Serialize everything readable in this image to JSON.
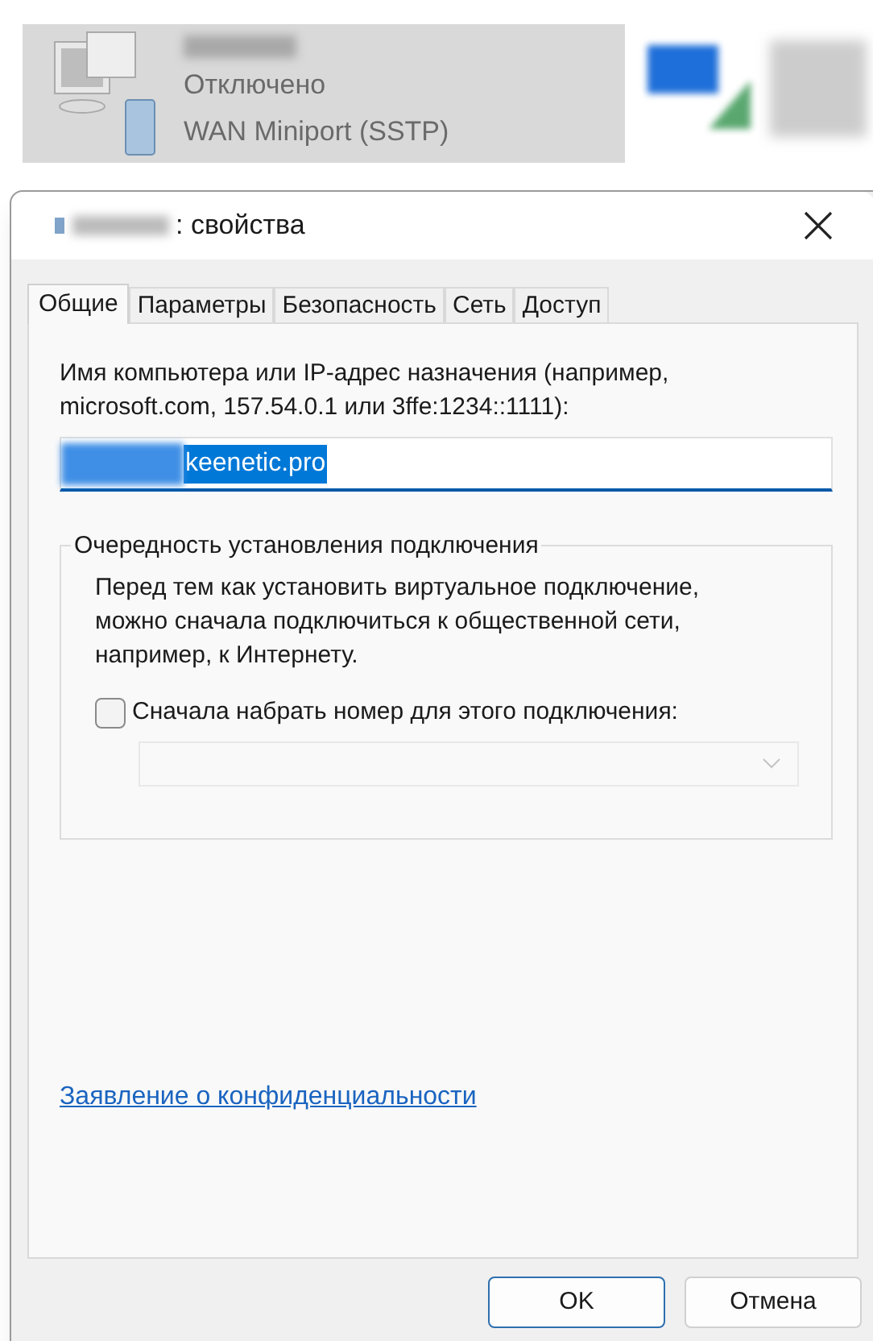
{
  "background_item": {
    "status": "Отключено",
    "device": "WAN Miniport (SSTP)"
  },
  "dialog": {
    "title": ": свойства"
  },
  "tabs": [
    {
      "label": "Общие",
      "selected": true
    },
    {
      "label": "Параметры",
      "selected": false
    },
    {
      "label": "Безопасность",
      "selected": false
    },
    {
      "label": "Сеть",
      "selected": false
    },
    {
      "label": "Доступ",
      "selected": false
    }
  ],
  "host_label": "Имя компьютера или IP-адрес назначения (например, microsoft.com, 157.54.0.1 или 3ffe:1234::1111):",
  "host_field": {
    "value": "keenetic.pro",
    "selected": true
  },
  "group": {
    "title": "Очередность установления подключения",
    "description": "Перед тем как установить виртуальное подключение, можно сначала подключиться к общественной сети, например, к Интернету.",
    "checkbox": {
      "label": "Сначала набрать номер для этого подключения:",
      "checked": false
    },
    "dropdown": {
      "disabled": true
    }
  },
  "privacy_link": "Заявление о конфиденциальности",
  "buttons": [
    {
      "label": "OK",
      "kind": "default"
    },
    {
      "label": "Отмена",
      "kind": "normal"
    }
  ]
}
